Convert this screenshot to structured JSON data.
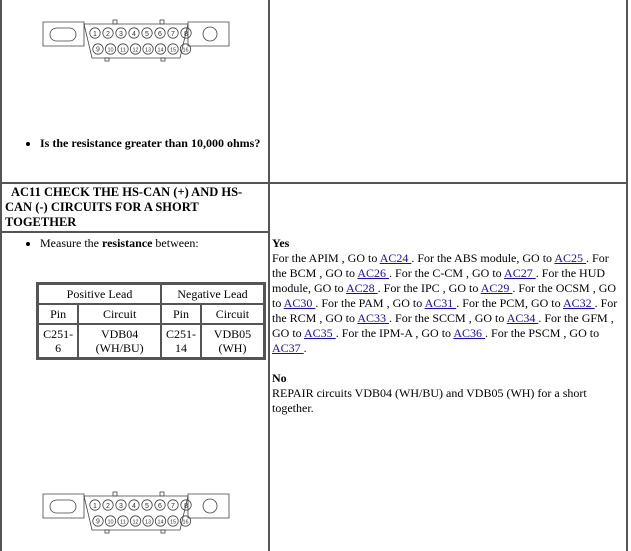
{
  "top_left": {
    "connector_image": "dlc-16-pin-connector",
    "pins_top": [
      "1",
      "2",
      "3",
      "4",
      "5",
      "6",
      "7",
      "8"
    ],
    "pins_bottom": [
      "9",
      "10",
      "11",
      "12",
      "13",
      "14",
      "15",
      "16"
    ],
    "question": "Is the resistance greater than 10,000 ohms?"
  },
  "step": {
    "title": "AC11 CHECK THE HS-CAN (+) AND HS-CAN (-) CIRCUITS FOR A SHORT TOGETHER",
    "instruction_prefix": "Measure the ",
    "instruction_bold": "resistance",
    "instruction_suffix": " between:",
    "table": {
      "groups": [
        "Positive Lead",
        "Negative Lead"
      ],
      "headers": [
        "Pin",
        "Circuit",
        "Pin",
        "Circuit"
      ],
      "rows": [
        [
          "C251-6",
          "VDB04 (WH/BU)",
          "C251-14",
          "VDB05 (WH)"
        ]
      ],
      "cells_display": [
        "C251-",
        "6",
        "VDB04",
        "(WH/BU)",
        "C251-",
        "14",
        "VDB05",
        "(WH)"
      ]
    }
  },
  "results": {
    "yes_label": "Yes",
    "yes_items": [
      {
        "prefix": "For the APIM , GO to ",
        "link": "AC24"
      },
      {
        "prefix": ". For the ABS module, GO to ",
        "link": "AC25"
      },
      {
        "prefix": ". For the BCM , GO to ",
        "link": "AC26"
      },
      {
        "prefix": ". For the C-CM , GO to ",
        "link": "AC27"
      },
      {
        "prefix": ". For the HUD module, GO to ",
        "link": "AC28"
      },
      {
        "prefix": ". For the IPC , GO to ",
        "link": "AC29"
      },
      {
        "prefix": ". For the OCSM , GO to ",
        "link": "AC30"
      },
      {
        "prefix": ". For the PAM , GO to ",
        "link": "AC31"
      },
      {
        "prefix": ". For the PCM, GO to ",
        "link": "AC32"
      },
      {
        "prefix": ". For the RCM , GO to ",
        "link": "AC33"
      },
      {
        "prefix": ". For the SCCM , GO to ",
        "link": "AC34"
      },
      {
        "prefix": ". For the GFM , GO to ",
        "link": "AC35"
      },
      {
        "prefix": ". For the IPM-A , GO to ",
        "link": "AC36"
      },
      {
        "prefix": ". For the PSCM , GO to ",
        "link": "AC37"
      }
    ],
    "yes_suffix": ".",
    "no_label": "No",
    "no_text": "REPAIR circuits VDB04 (WH/BU) and VDB05 (WH) for a short together."
  },
  "colors": {
    "link": "#1a0dab",
    "border": "#555555"
  }
}
